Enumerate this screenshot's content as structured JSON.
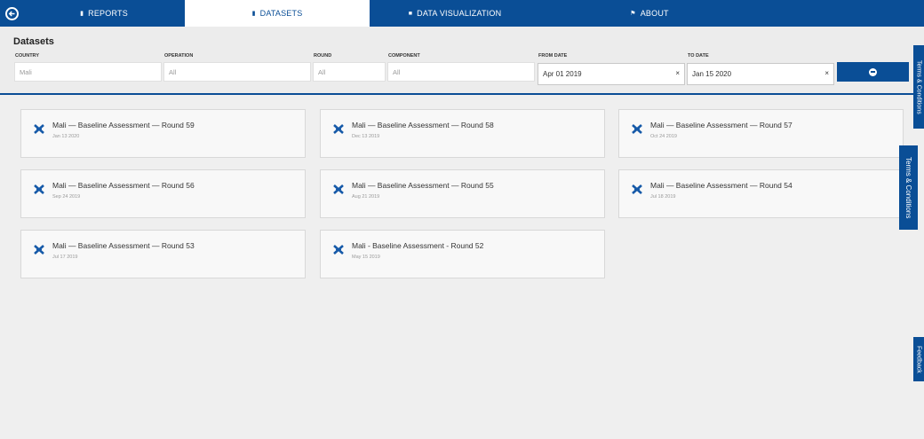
{
  "nav": {
    "tabs": [
      {
        "label": "REPORTS",
        "icon": "document-icon"
      },
      {
        "label": "DATASETS",
        "icon": "document-icon"
      },
      {
        "label": "DATA VISUALIZATION",
        "icon": "chat-icon"
      },
      {
        "label": "ABOUT",
        "icon": "flag-icon"
      }
    ],
    "active_tab": "DATASETS"
  },
  "filters": {
    "title": "Datasets",
    "country": {
      "label": "COUNTRY",
      "value": "Mali"
    },
    "operation": {
      "label": "OPERATION",
      "value": "All"
    },
    "round": {
      "label": "ROUND",
      "value": "All"
    },
    "component": {
      "label": "COMPONENT",
      "value": "All"
    },
    "from_date": {
      "label": "FROM DATE",
      "value": "Apr 01 2019"
    },
    "to_date": {
      "label": "TO DATE",
      "value": "Jan 15 2020"
    },
    "clear_symbol": "×"
  },
  "datasets": [
    {
      "title": "Mali — Baseline Assessment — Round 59",
      "date": "Jan 13 2020"
    },
    {
      "title": "Mali — Baseline Assessment — Round 58",
      "date": "Dec 13 2019"
    },
    {
      "title": "Mali — Baseline Assessment — Round 57",
      "date": "Oct 24 2019"
    },
    {
      "title": "Mali — Baseline Assessment — Round 56",
      "date": "Sep 24 2019"
    },
    {
      "title": "Mali — Baseline Assessment — Round 55",
      "date": "Aug 21 2019"
    },
    {
      "title": "Mali — Baseline Assessment — Round 54",
      "date": "Jul 18 2019"
    },
    {
      "title": "Mali — Baseline Assessment — Round 53",
      "date": "Jul 17 2019"
    },
    {
      "title": "Mali - Baseline Assessment - Round 52",
      "date": "May 15 2019"
    }
  ],
  "side_tabs": {
    "terms_top": "Terms & Conditions",
    "terms": "Terms & Conditions",
    "feedback": "Feedback"
  },
  "colors": {
    "brand": "#0a4e96",
    "background": "#efefef"
  }
}
